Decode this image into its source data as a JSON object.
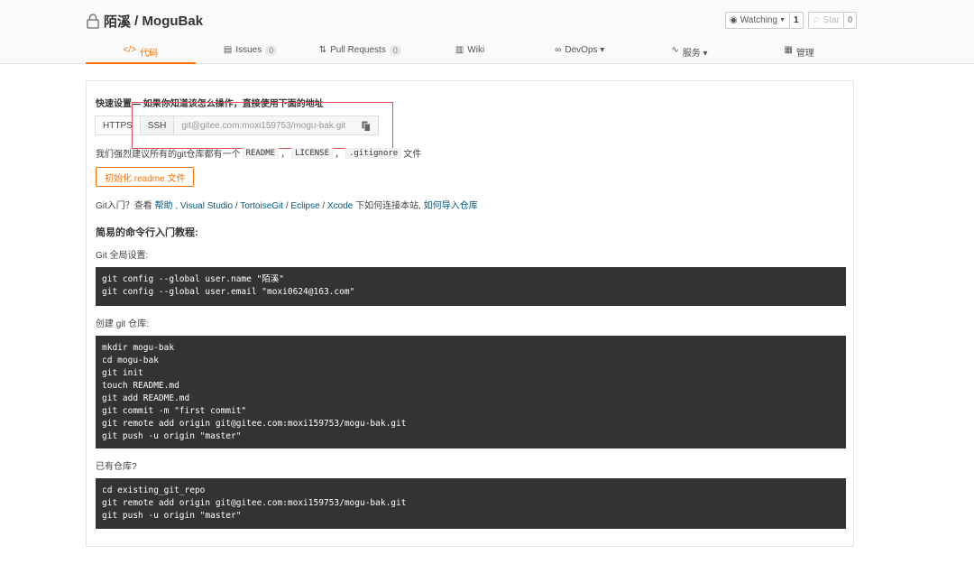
{
  "header": {
    "owner": "陌溪",
    "separator": " / ",
    "repo": "MoguBak",
    "watch_label": "Watching",
    "watch_count": "1",
    "star_label": "Star",
    "star_count": "0"
  },
  "tabs": [
    {
      "icon": "</>",
      "label": "代码",
      "active": true
    },
    {
      "icon": "▤",
      "label": "Issues",
      "badge": "0"
    },
    {
      "icon": "⇅",
      "label": "Pull Requests",
      "badge": "0"
    },
    {
      "icon": "▥",
      "label": "Wiki"
    },
    {
      "icon": "∞",
      "label": "DevOps ▾"
    },
    {
      "icon": "∿",
      "label": "服务 ▾"
    },
    {
      "icon": "▦",
      "label": "管理"
    }
  ],
  "quick": {
    "title": "快速设置— 如果你知道该怎么操作，直接使用下面的地址",
    "https_label": "HTTPS",
    "ssh_label": "SSH",
    "url": "git@gitee.com:moxi159753/mogu-bak.git",
    "note_prefix": "我们强烈建议所有的git仓库都有一个",
    "note_readme": "README",
    "note_sep1": "，",
    "note_license": "LICENSE",
    "note_sep2": "，",
    "note_gitignore": ".gitignore",
    "note_suffix": "文件",
    "init_button": "初始化 readme 文件"
  },
  "git_intro": {
    "prefix": "Git入门？查看 ",
    "help": "帮助",
    "sep0": " , ",
    "vs": "Visual Studio",
    "sep1": " / ",
    "tortoise": "TortoiseGit",
    "sep2": " / ",
    "eclipse": "Eclipse",
    "sep3": " / ",
    "xcode": "Xcode",
    "mid": " 下如何连接本站, ",
    "import": "如何导入仓库"
  },
  "tutorial": {
    "title": "简易的命令行入门教程:",
    "global_label": "Git 全局设置:",
    "global_code": "git config --global user.name \"陌溪\"\ngit config --global user.email \"moxi0624@163.com\"",
    "create_label": "创建 git 仓库:",
    "create_code": "mkdir mogu-bak\ncd mogu-bak\ngit init\ntouch README.md\ngit add README.md\ngit commit -m \"first commit\"\ngit remote add origin git@gitee.com:moxi159753/mogu-bak.git\ngit push -u origin \"master\"",
    "existing_label": "已有仓库?",
    "existing_code": "cd existing_git_repo\ngit remote add origin git@gitee.com:moxi159753/mogu-bak.git\ngit push -u origin \"master\""
  },
  "colors": {
    "accent": "#fe7300",
    "link": "#005980",
    "code_bg": "#333333",
    "annotation": "#e05560"
  }
}
